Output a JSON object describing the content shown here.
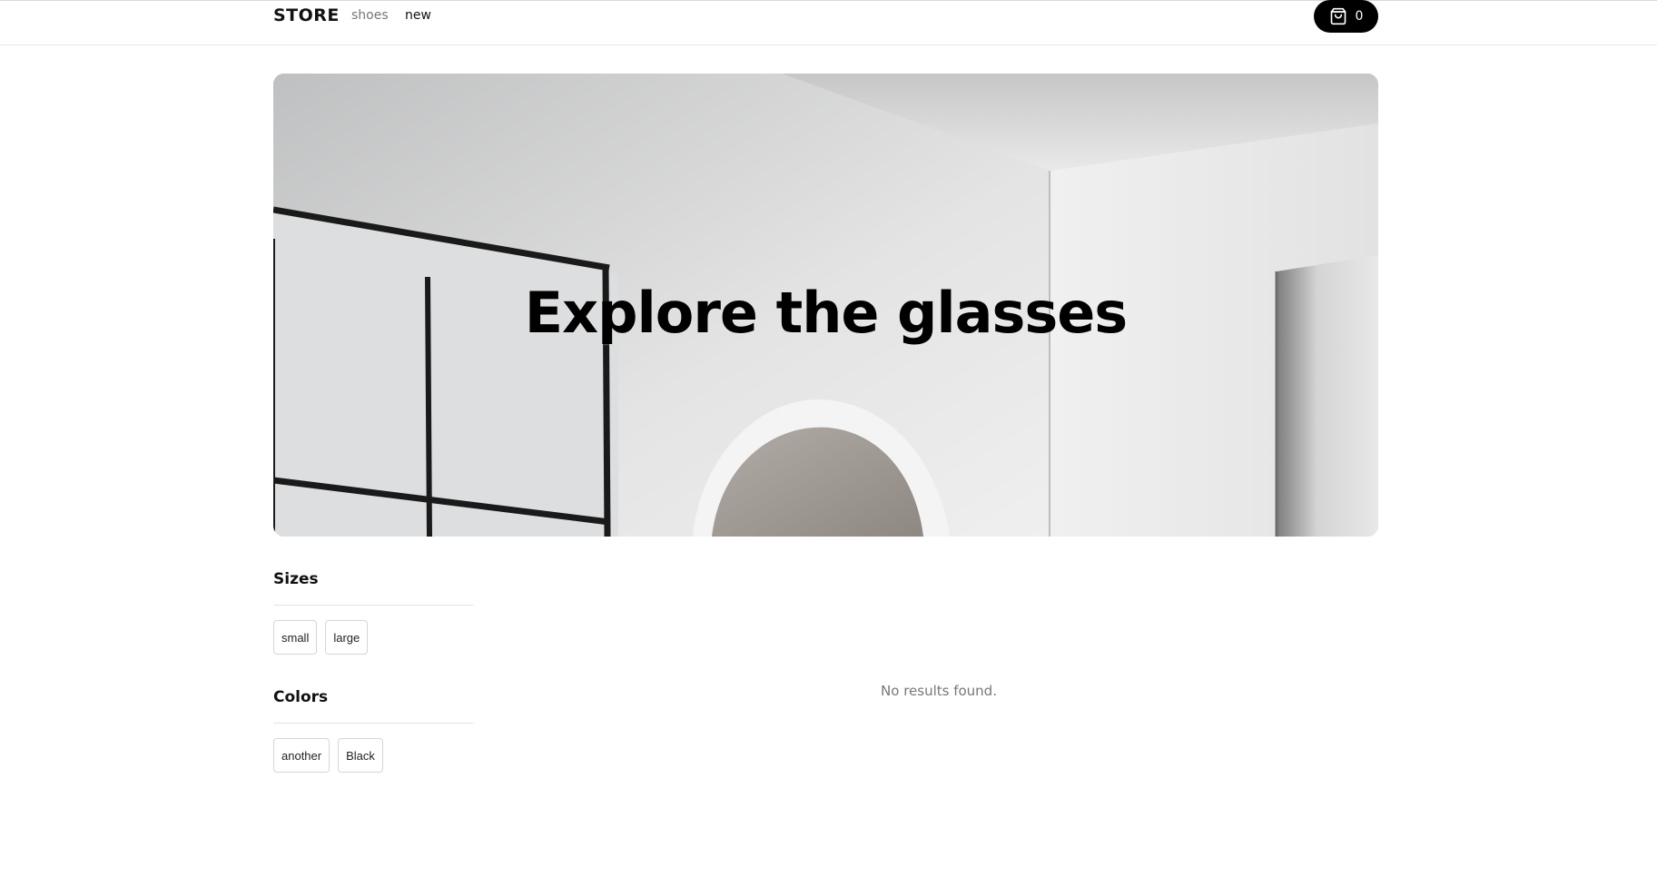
{
  "header": {
    "brand": "STORE",
    "nav": [
      {
        "label": "shoes"
      },
      {
        "label": "new"
      }
    ],
    "cart": {
      "icon": "shopping-bag-icon",
      "count": "0"
    }
  },
  "hero": {
    "title": "Explore the glasses"
  },
  "filters": {
    "sizes": {
      "heading": "Sizes",
      "options": [
        "small",
        "large"
      ]
    },
    "colors": {
      "heading": "Colors",
      "options": [
        "another",
        "Black"
      ]
    }
  },
  "results": {
    "empty_message": "No results found."
  },
  "colors": {
    "primary": "#000000",
    "background": "#ffffff",
    "muted_text": "#777777",
    "border": "#d5d5d5"
  }
}
